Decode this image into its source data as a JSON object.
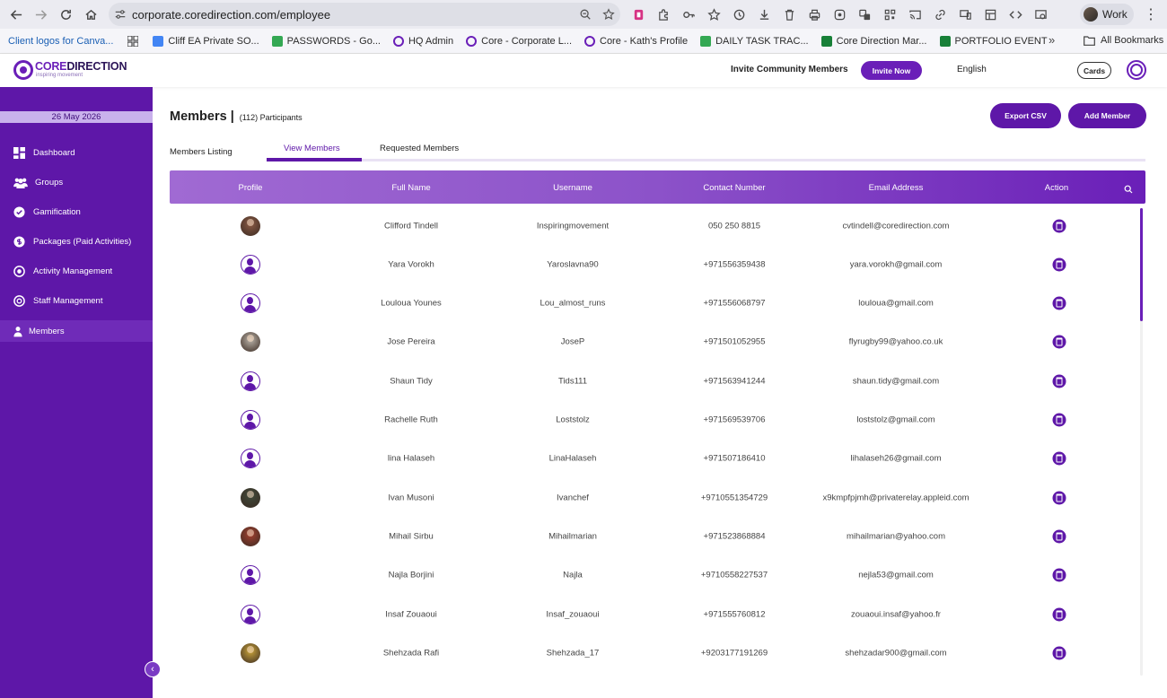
{
  "browser": {
    "url": "corporate.coredirection.com/employee",
    "profile_label": "Work",
    "bookmarks": [
      {
        "label": "Client logos for Canva...",
        "color": "#1a5fb4"
      },
      {
        "label": "Cliff EA Private SO...",
        "color": "#4285f4"
      },
      {
        "label": "PASSWORDS - Go...",
        "color": "#34a853"
      },
      {
        "label": "HQ Admin",
        "color": "#6a1fb8"
      },
      {
        "label": "Core - Corporate L...",
        "color": "#6a1fb8"
      },
      {
        "label": "Core - Kath's Profile",
        "color": "#6a1fb8"
      },
      {
        "label": "DAILY TASK TRAC...",
        "color": "#34a853"
      },
      {
        "label": "Core Direction Mar...",
        "color": "#188038"
      },
      {
        "label": "PORTFOLIO EVENT",
        "color": "#188038"
      }
    ],
    "all_bookmarks_label": "All Bookmarks"
  },
  "header": {
    "logo_core": "CORE",
    "logo_direction": "DIRECTION",
    "logo_tagline": "inspiring movement",
    "invite_text": "Invite Community Members",
    "invite_button": "Invite Now",
    "language": "English",
    "cards_button": "Cards"
  },
  "sidebar": {
    "date": "26 May 2026",
    "items": [
      {
        "label": "Dashboard",
        "icon": "dashboard-icon"
      },
      {
        "label": "Groups",
        "icon": "groups-icon"
      },
      {
        "label": "Gamification",
        "icon": "gamification-icon"
      },
      {
        "label": "Packages (Paid Activities)",
        "icon": "packages-icon"
      },
      {
        "label": "Activity Management",
        "icon": "activity-icon"
      },
      {
        "label": "Staff Management",
        "icon": "staff-icon"
      },
      {
        "label": "Members",
        "icon": "members-icon",
        "active": true
      }
    ]
  },
  "page": {
    "title": "Members |",
    "participants": "(112) Participants",
    "export_button": "Export CSV",
    "add_button": "Add Member",
    "tabs": {
      "listing": "Members Listing",
      "view": "View Members",
      "requested": "Requested Members"
    }
  },
  "table": {
    "columns": [
      "Profile",
      "Full Name",
      "Username",
      "Contact Number",
      "Email Address",
      "Action"
    ],
    "rows": [
      {
        "name": "Clifford Tindell",
        "username": "Inspiringmovement",
        "phone": "050 250 8815",
        "email": "cvtindell@coredirection.com",
        "avatar": "photo",
        "tint": "#8a5a44"
      },
      {
        "name": "Yara Vorokh",
        "username": "Yaroslavna90",
        "phone": "+971556359438",
        "email": "yara.vorokh@gmail.com",
        "avatar": "default"
      },
      {
        "name": "Louloua Younes",
        "username": "Lou_almost_runs",
        "phone": "+971556068797",
        "email": "louloua@gmail.com",
        "avatar": "default"
      },
      {
        "name": "Jose Pereira",
        "username": "JoseP",
        "phone": "+971501052955",
        "email": "flyrugby99@yahoo.co.uk",
        "avatar": "photo",
        "tint": "#b9b2a8"
      },
      {
        "name": "Shaun Tidy",
        "username": "Tids111",
        "phone": "+971563941244",
        "email": "shaun.tidy@gmail.com",
        "avatar": "default"
      },
      {
        "name": "Rachelle Ruth",
        "username": "Loststolz",
        "phone": "+971569539706",
        "email": "loststolz@gmail.com",
        "avatar": "default"
      },
      {
        "name": "lina Halaseh",
        "username": "LinaHalaseh",
        "phone": "+971507186410",
        "email": "lihalaseh26@gmail.com",
        "avatar": "default"
      },
      {
        "name": "Ivan Musoni",
        "username": "Ivanchef",
        "phone": "+9710551354729",
        "email": "x9kmpfpjmh@privaterelay.appleid.com",
        "avatar": "photo",
        "tint": "#3f4a3a"
      },
      {
        "name": "Mihail Sirbu",
        "username": "Mihailmarian",
        "phone": "+971523868884",
        "email": "mihailmarian@yahoo.com",
        "avatar": "photo",
        "tint": "#a2402f"
      },
      {
        "name": "Najla Borjini",
        "username": "Najla",
        "phone": "+9710558227537",
        "email": "nejla53@gmail.com",
        "avatar": "default"
      },
      {
        "name": "Insaf Zouaoui",
        "username": "Insaf_zouaoui",
        "phone": "+971555760812",
        "email": "zouaoui.insaf@yahoo.fr",
        "avatar": "default"
      },
      {
        "name": "Shehzada Rafi",
        "username": "Shehzada_17",
        "phone": "+9203177191269",
        "email": "shehzadar900@gmail.com",
        "avatar": "photo",
        "tint": "#c9a43a"
      }
    ]
  },
  "colors": {
    "brand": "#5e17a8",
    "brand_light": "#c9b1ec"
  }
}
